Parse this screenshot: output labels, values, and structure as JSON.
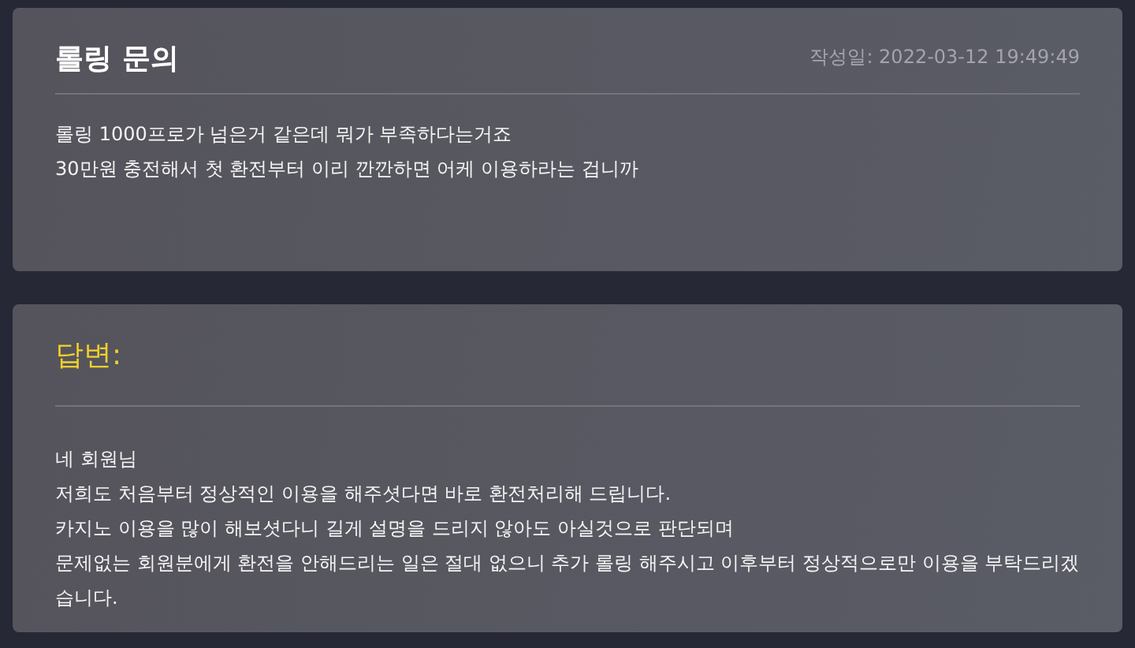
{
  "question": {
    "title": "롤링 문의",
    "date": "작성일: 2022-03-12 19:49:49",
    "lines": [
      "롤링 1000프로가 넘은거 같은데 뭐가 부족하다는거죠",
      "30만원 충전해서 첫 환전부터 이리 깐깐하면 어케 이용하라는 겁니까"
    ]
  },
  "answer": {
    "title": "답변:",
    "lines": [
      "네 회원님",
      "저희도 처음부터 정상적인 이용을 해주셧다면 바로 환전처리해 드립니다.",
      "카지노 이용을 많이 해보셧다니 길게 설명을 드리지 않아도 아실것으로 판단되며",
      "문제없는 회원분에게 환전을 안해드리는 일은 절대 없으니 추가 롤링 해주시고 이후부터 정상적으로만 이용을 부탁드리겠습니다."
    ]
  }
}
